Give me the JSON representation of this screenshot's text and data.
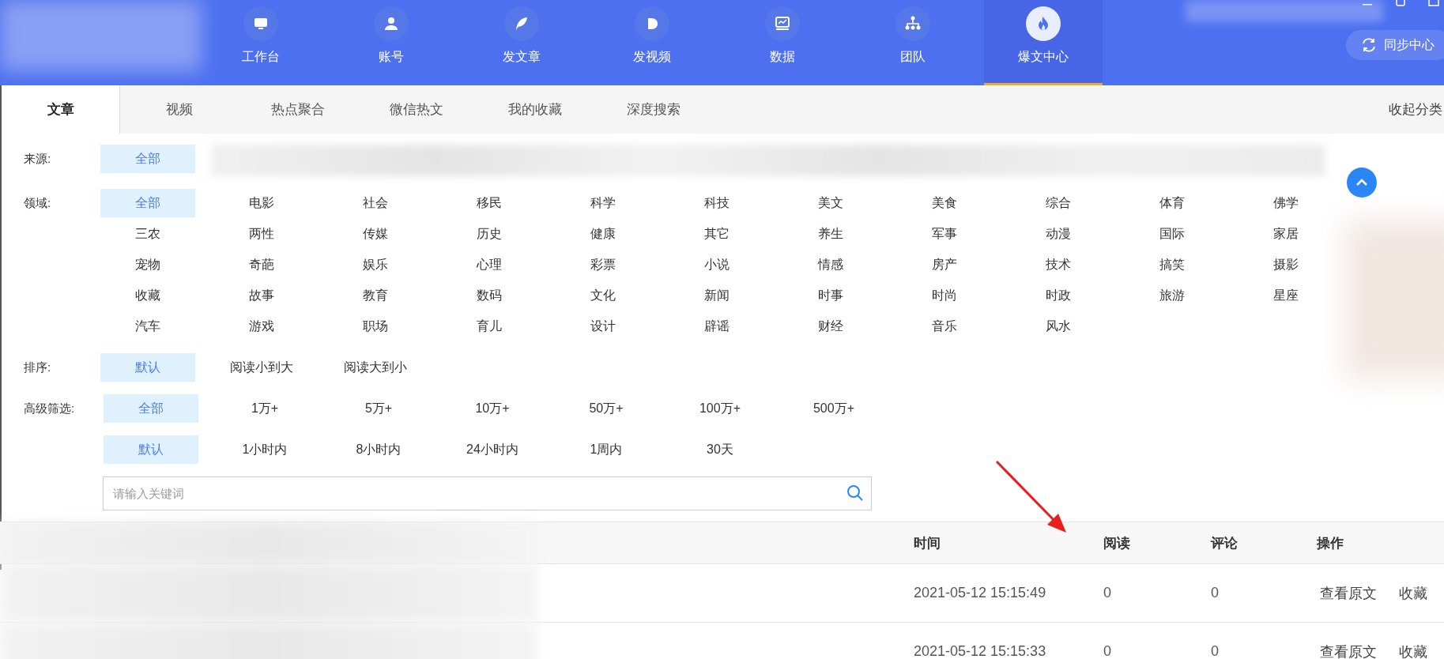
{
  "nav": {
    "items": [
      {
        "label": "工作台",
        "selected": false
      },
      {
        "label": "账号",
        "selected": false
      },
      {
        "label": "发文章",
        "selected": false
      },
      {
        "label": "发视频",
        "selected": false
      },
      {
        "label": "数据",
        "selected": false
      },
      {
        "label": "团队",
        "selected": false
      },
      {
        "label": "爆文中心",
        "selected": true
      }
    ]
  },
  "sync_button": {
    "label": "同步中心"
  },
  "tabs": [
    {
      "label": "文章",
      "selected": true
    },
    {
      "label": "视频",
      "selected": false
    },
    {
      "label": "热点聚合",
      "selected": false
    },
    {
      "label": "微信热文",
      "selected": false
    },
    {
      "label": "我的收藏",
      "selected": false
    },
    {
      "label": "深度搜索",
      "selected": false
    }
  ],
  "collapse_link": "收起分类",
  "filters": [
    {
      "kind": "source",
      "label": "来源:",
      "options": [
        {
          "label": "全部",
          "selected": true
        }
      ]
    },
    {
      "kind": "domain",
      "label": "领域:",
      "options": [
        {
          "label": "全部",
          "selected": true
        },
        {
          "label": "电影",
          "selected": false
        },
        {
          "label": "社会",
          "selected": false
        },
        {
          "label": "移民",
          "selected": false
        },
        {
          "label": "科学",
          "selected": false
        },
        {
          "label": "科技",
          "selected": false
        },
        {
          "label": "美文",
          "selected": false
        },
        {
          "label": "美食",
          "selected": false
        },
        {
          "label": "综合",
          "selected": false
        },
        {
          "label": "体育",
          "selected": false
        },
        {
          "label": "佛学",
          "selected": false
        },
        {
          "label": "三农",
          "selected": false
        },
        {
          "label": "两性",
          "selected": false
        },
        {
          "label": "传媒",
          "selected": false
        },
        {
          "label": "历史",
          "selected": false
        },
        {
          "label": "健康",
          "selected": false
        },
        {
          "label": "其它",
          "selected": false
        },
        {
          "label": "养生",
          "selected": false
        },
        {
          "label": "军事",
          "selected": false
        },
        {
          "label": "动漫",
          "selected": false
        },
        {
          "label": "国际",
          "selected": false
        },
        {
          "label": "家居",
          "selected": false
        },
        {
          "label": "宠物",
          "selected": false
        },
        {
          "label": "奇葩",
          "selected": false
        },
        {
          "label": "娱乐",
          "selected": false
        },
        {
          "label": "心理",
          "selected": false
        },
        {
          "label": "彩票",
          "selected": false
        },
        {
          "label": "小说",
          "selected": false
        },
        {
          "label": "情感",
          "selected": false
        },
        {
          "label": "房产",
          "selected": false
        },
        {
          "label": "技术",
          "selected": false
        },
        {
          "label": "搞笑",
          "selected": false
        },
        {
          "label": "摄影",
          "selected": false
        },
        {
          "label": "收藏",
          "selected": false
        },
        {
          "label": "故事",
          "selected": false
        },
        {
          "label": "教育",
          "selected": false
        },
        {
          "label": "数码",
          "selected": false
        },
        {
          "label": "文化",
          "selected": false
        },
        {
          "label": "新闻",
          "selected": false
        },
        {
          "label": "时事",
          "selected": false
        },
        {
          "label": "时尚",
          "selected": false
        },
        {
          "label": "时政",
          "selected": false
        },
        {
          "label": "旅游",
          "selected": false
        },
        {
          "label": "星座",
          "selected": false
        },
        {
          "label": "汽车",
          "selected": false
        },
        {
          "label": "游戏",
          "selected": false
        },
        {
          "label": "职场",
          "selected": false
        },
        {
          "label": "育儿",
          "selected": false
        },
        {
          "label": "设计",
          "selected": false
        },
        {
          "label": "辟谣",
          "selected": false
        },
        {
          "label": "财经",
          "selected": false
        },
        {
          "label": "音乐",
          "selected": false
        },
        {
          "label": "风水",
          "selected": false
        }
      ]
    },
    {
      "kind": "sort",
      "label": "排序:",
      "options": [
        {
          "label": "默认",
          "selected": true
        },
        {
          "label": "阅读小到大",
          "selected": false
        },
        {
          "label": "阅读大到小",
          "selected": false
        }
      ]
    },
    {
      "kind": "reads",
      "label": "高级筛选:",
      "options": [
        {
          "label": "全部",
          "selected": true
        },
        {
          "label": "1万+",
          "selected": false
        },
        {
          "label": "5万+",
          "selected": false
        },
        {
          "label": "10万+",
          "selected": false
        },
        {
          "label": "50万+",
          "selected": false
        },
        {
          "label": "100万+",
          "selected": false
        },
        {
          "label": "500万+",
          "selected": false
        }
      ]
    },
    {
      "kind": "time",
      "options": [
        {
          "label": "默认",
          "selected": true
        },
        {
          "label": "1小时内",
          "selected": false
        },
        {
          "label": "8小时内",
          "selected": false
        },
        {
          "label": "24小时内",
          "selected": false
        },
        {
          "label": "1周内",
          "selected": false
        },
        {
          "label": "30天",
          "selected": false
        }
      ]
    }
  ],
  "search": {
    "placeholder": "请输入关键词"
  },
  "table": {
    "columns": [
      "时间",
      "阅读",
      "评论",
      "操作"
    ],
    "rows": [
      {
        "time": "2021-05-12 15:15:49",
        "reads": "0",
        "comments": "0",
        "actions": [
          "查看原文",
          "收藏"
        ]
      },
      {
        "time": "2021-05-12 15:15:33",
        "reads": "0",
        "comments": "0",
        "actions": [
          "查看原文",
          "收藏"
        ]
      }
    ]
  }
}
